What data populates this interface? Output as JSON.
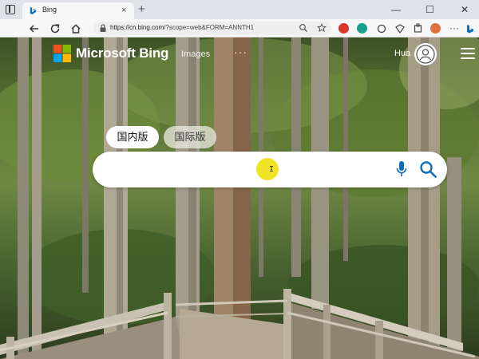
{
  "browser": {
    "tab_title": "Bing",
    "tab_close": "×",
    "new_tab": "+",
    "window": {
      "minimize": "—",
      "maximize": "☐",
      "close": "✕"
    },
    "url_host": "https://cn.bing.com",
    "url_path": "/?scope=web&FORM=ANNTH1"
  },
  "header": {
    "brand": "Microsoft Bing",
    "nav_images": "Images",
    "nav_more": "···",
    "user_name": "Hua"
  },
  "search": {
    "scope_domestic": "国内版",
    "scope_international": "国际版",
    "query": "",
    "cursor_glyph": "I"
  },
  "colors": {
    "bing_blue": "#0f6cbd",
    "logo_red": "#f25022",
    "logo_green": "#7fba00",
    "logo_blue": "#00a4ef",
    "logo_yellow": "#ffb900",
    "cursor_highlight": "#f1e325"
  },
  "icons": [
    "sidebar-toggle-icon",
    "bing-favicon",
    "back-icon",
    "refresh-icon",
    "home-icon",
    "lock-icon",
    "zoom-icon",
    "favorite-icon",
    "microphone-icon",
    "search-icon",
    "user-avatar-icon",
    "hamburger-menu-icon"
  ]
}
